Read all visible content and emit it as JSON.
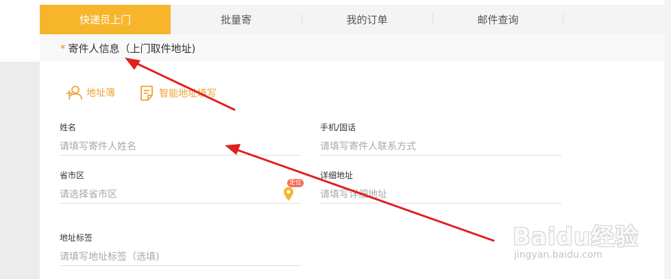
{
  "tabs": [
    {
      "label": "快递员上门",
      "active": true
    },
    {
      "label": "批量寄",
      "active": false
    },
    {
      "label": "我的订单",
      "active": false
    },
    {
      "label": "邮件查询",
      "active": false
    }
  ],
  "section": {
    "required_mark": "*",
    "title": "寄件人信息（上门取件地址)"
  },
  "tools": {
    "address_book": "地址簿",
    "smart_fill": "智能地址填写"
  },
  "fields": {
    "name": {
      "label": "姓名",
      "placeholder": "请填写寄件人姓名"
    },
    "phone": {
      "label": "手机/固话",
      "placeholder": "请填写寄件人联系方式"
    },
    "region": {
      "label": "省市区",
      "placeholder": "请选择省市区"
    },
    "detail": {
      "label": "详细地址",
      "placeholder": "请填写详细地址"
    },
    "tag": {
      "label": "地址标签",
      "placeholder": "请填写地址标签（选填)"
    }
  },
  "locate": {
    "label": "定位"
  },
  "watermark": {
    "logo": "Baidu经验",
    "url": "jingyan.baidu.com"
  },
  "colors": {
    "accent": "#f7b52c",
    "tool": "#f0a233",
    "arrow": "#e02020",
    "badge": "#f06a54"
  },
  "icons": [
    "add-contact-icon",
    "note-icon",
    "location-pin-icon",
    "paw-icon"
  ]
}
